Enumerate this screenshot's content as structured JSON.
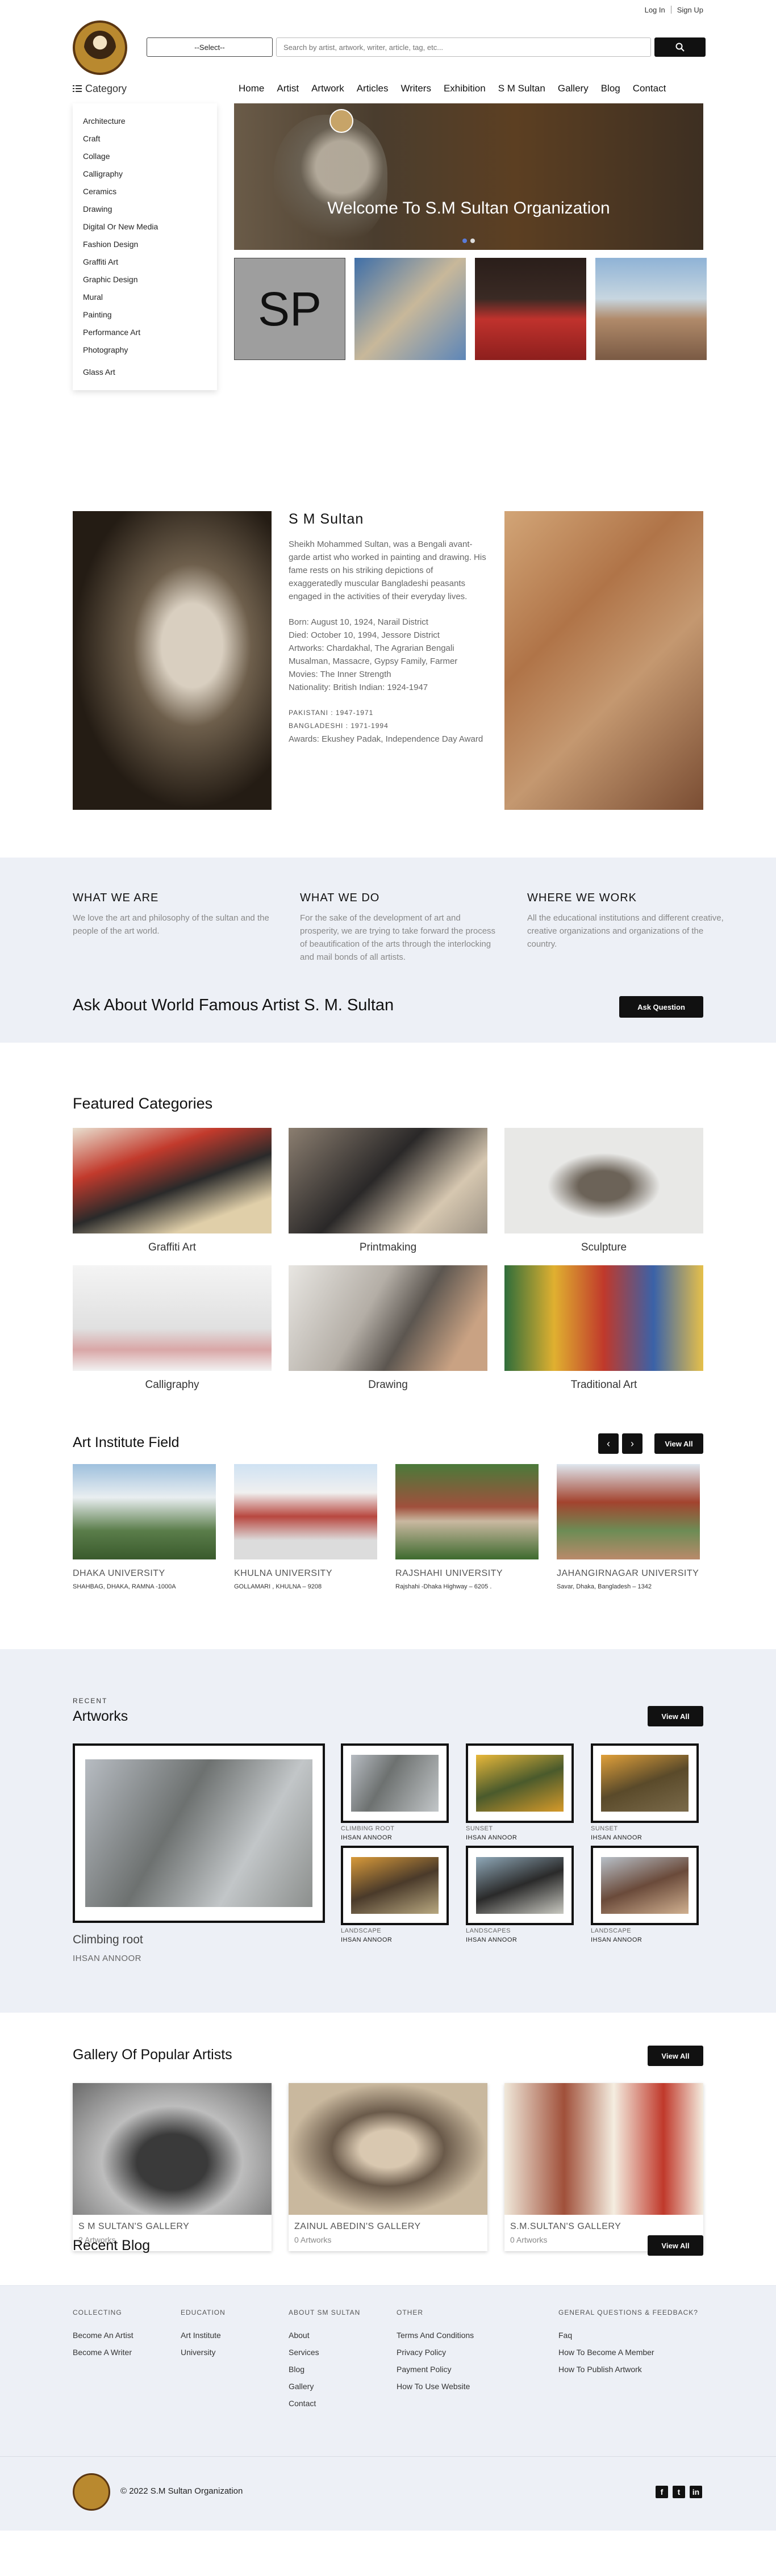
{
  "header": {
    "login": "Log In",
    "signup": "Sign Up",
    "select_label": "--Select--",
    "search_placeholder": "Search by artist, artwork, writer, article, tag, etc...",
    "category_label": "Category",
    "nav": [
      "Home",
      "Artist",
      "Artwork",
      "Articles",
      "Writers",
      "Exhibition",
      "S M Sultan",
      "Gallery",
      "Blog",
      "Contact"
    ]
  },
  "categories": [
    "Architecture",
    "Craft",
    "Collage",
    "Calligraphy",
    "Ceramics",
    "Drawing",
    "Digital Or New Media",
    "Fashion Design",
    "Graffiti Art",
    "Graphic Design",
    "Mural",
    "Painting",
    "Performance Art",
    "Photography",
    "Glass Art"
  ],
  "hero": {
    "title": "Welcome To S.M Sultan Organization",
    "sp_text": "SP"
  },
  "about": {
    "name": "S M Sultan",
    "bio": "Sheikh Mohammed Sultan, was a Bengali avant-garde artist who worked in painting and drawing. His fame rests on his striking depictions of exaggeratedly muscular Bangladeshi peasants engaged in the activities of their everyday lives.",
    "born": "Born: August 10, 1924, Narail District",
    "died": "Died: October 10, 1994, Jessore District",
    "artworks": "Artworks: Chardakhal, The Agrarian Bengali Musalman, Massacre, Gypsy Family, Farmer",
    "movies": "Movies: The Inner Strength",
    "nationality": "Nationality: British Indian: 1924-1947",
    "pakistani": "PAKISTANI : 1947-1971",
    "bangladeshi": "BANGLADESHI : 1971-1994",
    "awards": "Awards: Ekushey Padak, Independence Day Award"
  },
  "what": {
    "cols": [
      {
        "title": "WHAT WE ARE",
        "text": "We love the art and philosophy of the sultan and the people of the art world."
      },
      {
        "title": "WHAT WE DO",
        "text": "For the sake of the development of art and prosperity, we are trying to take forward the process of beautification of the arts through the interlocking and mail bonds of all artists."
      },
      {
        "title": "WHERE WE WORK",
        "text": "All the educational institutions and different creative, creative organizations and organizations of the country."
      }
    ],
    "ask_title": "Ask About World Famous Artist S. M. Sultan",
    "ask_button": "Ask Question"
  },
  "featured": {
    "title": "Featured Categories",
    "items": [
      "Graffiti Art",
      "Printmaking",
      "Sculpture",
      "Calligraphy",
      "Drawing",
      "Traditional Art"
    ]
  },
  "institutes": {
    "title": "Art Institute Field",
    "view_all": "View All",
    "items": [
      {
        "name": "DHAKA UNIVERSITY",
        "addr": "SHAHBAG, DHAKA, RAMNA -1000A"
      },
      {
        "name": "KHULNA UNIVERSITY",
        "addr": "GOLLAMARI , KHULNA – 9208"
      },
      {
        "name": "RAJSHAHI UNIVERSITY",
        "addr": "Rajshahi -Dhaka Highway – 6205 ."
      },
      {
        "name": "JAHANGIRNAGAR UNIVERSITY",
        "addr": "Savar, Dhaka, Bangladesh – 1342"
      }
    ]
  },
  "artworks": {
    "kicker": "RECENT",
    "title": "Artworks",
    "view_all": "View All",
    "featured_title": "Climbing root",
    "featured_artist": "IHSAN ANNOOR",
    "items": [
      {
        "title": "CLIMBING ROOT",
        "artist": "IHSAN ANNOOR"
      },
      {
        "title": "SUNSET",
        "artist": "IHSAN ANNOOR"
      },
      {
        "title": "SUNSET",
        "artist": "IHSAN ANNOOR"
      },
      {
        "title": "LANDSCAPE",
        "artist": "IHSAN ANNOOR"
      },
      {
        "title": "LANDSCAPES",
        "artist": "IHSAN ANNOOR"
      },
      {
        "title": "LANDSCAPE",
        "artist": "IHSAN ANNOOR"
      }
    ]
  },
  "gallery": {
    "title": "Gallery Of Popular Artists",
    "view_all": "View All",
    "items": [
      {
        "name": "S M SULTAN'S GALLERY",
        "count": "2 Artworks"
      },
      {
        "name": "ZAINUL ABEDIN'S GALLERY",
        "count": "0 Artworks"
      },
      {
        "name": "S.M.SULTAN'S GALLERY",
        "count": "0 Artworks"
      }
    ],
    "blog_title": "Recent Blog",
    "blog_view_all": "View All"
  },
  "footer": {
    "cols": [
      {
        "title": "COLLECTING",
        "links": [
          "Become An Artist",
          "Become A Writer"
        ]
      },
      {
        "title": "EDUCATION",
        "links": [
          "Art Institute",
          "University"
        ]
      },
      {
        "title": "ABOUT SM SULTAN",
        "links": [
          "About",
          "Services",
          "Blog",
          "Gallery",
          "Contact"
        ]
      },
      {
        "title": "OTHER",
        "links": [
          "Terms And Conditions",
          "Privacy Policy",
          "Payment Policy",
          "How To Use Website"
        ]
      },
      {
        "title": "GENERAL QUESTIONS & FEEDBACK?",
        "links": [
          "Faq",
          "How To Become A Member",
          "How To Publish Artwork"
        ]
      }
    ],
    "copyright": "© 2022 S.M Sultan Organization",
    "social_icons": [
      "facebook-icon",
      "twitter-icon",
      "linkedin-icon"
    ]
  }
}
